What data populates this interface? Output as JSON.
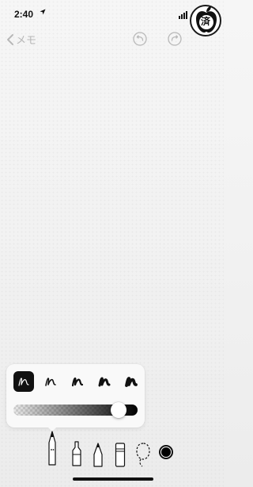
{
  "status_bar": {
    "time": "2:40",
    "location_icon": "location-arrow-icon",
    "signal_icon": "cellular-signal-icon"
  },
  "badge": {
    "label": "済",
    "icon": "apple-logo-icon"
  },
  "nav": {
    "back_label": "メモ",
    "back_icon": "chevron-left-icon",
    "undo_icon": "undo-icon",
    "redo_icon": "redo-icon"
  },
  "stroke_picker": {
    "selected_index": 0,
    "options": 5
  },
  "opacity_slider": {
    "value": 0.9
  },
  "tools": [
    "pen-icon",
    "marker-icon",
    "pencil-icon",
    "eraser-icon",
    "lasso-icon"
  ],
  "colors": {
    "selected_ink": "#000000",
    "accent_disabled": "#b8b8b8"
  }
}
